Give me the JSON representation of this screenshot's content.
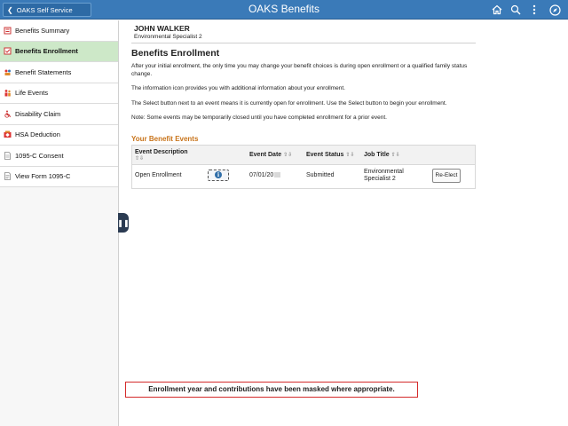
{
  "header": {
    "back_label": "OAKS Self Service",
    "title": "OAKS Benefits",
    "icons": [
      "home-icon",
      "search-icon",
      "menu-icon",
      "nav-compass-icon"
    ]
  },
  "sidebar": {
    "items": [
      {
        "label": "Benefits Summary",
        "icon": "summary-icon",
        "active": false
      },
      {
        "label": "Benefits Enrollment",
        "icon": "enrollment-icon",
        "active": true
      },
      {
        "label": "Benefit Statements",
        "icon": "statements-icon",
        "active": false
      },
      {
        "label": "Life Events",
        "icon": "people-icon",
        "active": false
      },
      {
        "label": "Disability Claim",
        "icon": "wheelchair-icon",
        "active": false
      },
      {
        "label": "HSA Deduction",
        "icon": "hsa-icon",
        "active": false
      },
      {
        "label": "1095-C Consent",
        "icon": "document-icon",
        "active": false
      },
      {
        "label": "View Form 1095-C",
        "icon": "form-icon",
        "active": false
      }
    ]
  },
  "employee": {
    "name": "JOHN WALKER",
    "title": "Environmental Specialist 2"
  },
  "main": {
    "page_title": "Benefits Enrollment",
    "paragraphs": [
      "After your initial enrollment, the only time you may change your benefit choices is during open enrollment or a qualified family status change.",
      "The information icon provides you with additional information about your enrollment.",
      "The Select button next to an event means it is currently open for enrollment. Use the Select button to begin your enrollment.",
      "Note: Some events may be temporarily closed until you have completed enrollment for a prior event."
    ],
    "section_title": "Your Benefit Events"
  },
  "events_table": {
    "columns": [
      "Event Description",
      "Event Date",
      "Event Status",
      "Job Title"
    ],
    "rows": [
      {
        "description": "Open Enrollment",
        "date": "07/01/20",
        "status": "Submitted",
        "job_title": "Environmental Specialist 2",
        "action": "Re-Elect"
      }
    ]
  },
  "notice": "Enrollment year and contributions have been masked where appropriate.",
  "colors": {
    "header_bg": "#3a7ab8",
    "active_nav": "#cde8c8",
    "section_title": "#c8741b",
    "notice_border": "#d42a2a"
  }
}
